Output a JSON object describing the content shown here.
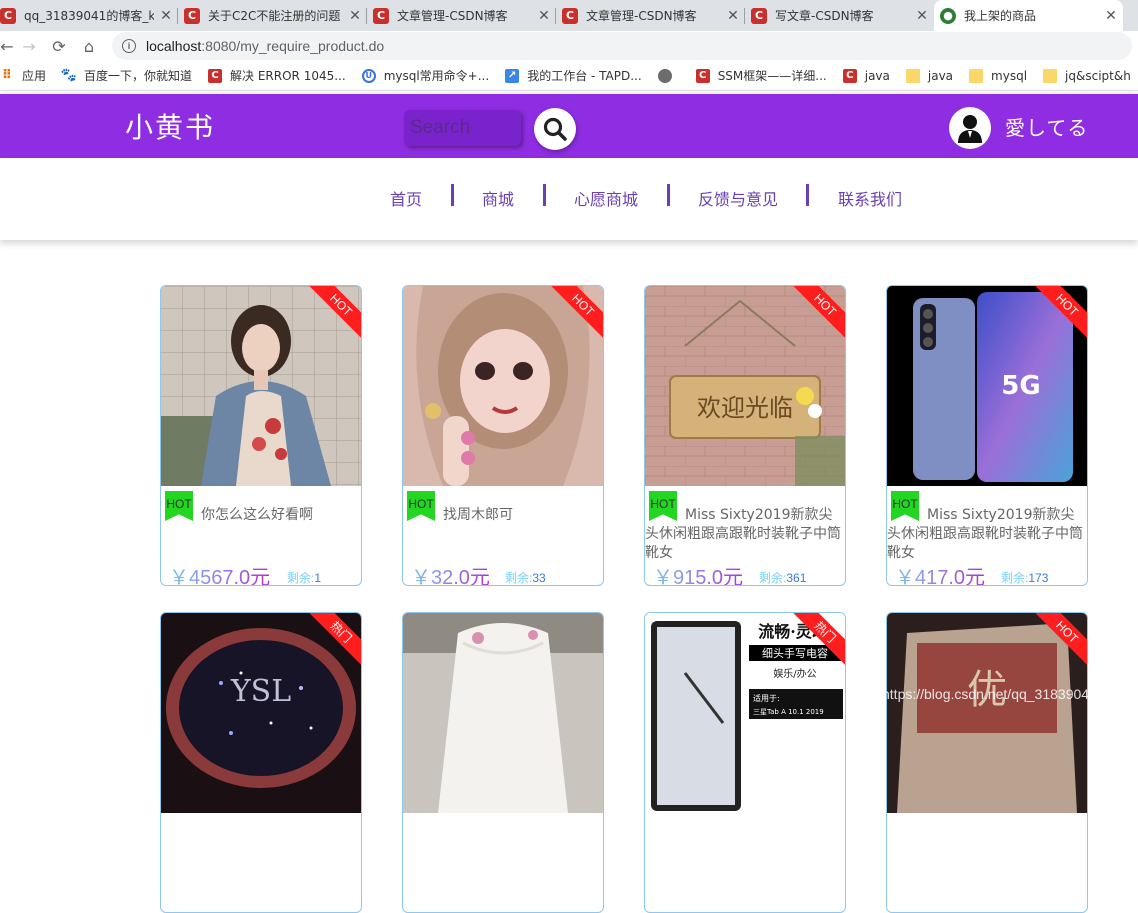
{
  "browser": {
    "tabs": [
      {
        "title": "qq_31839041的博客_k",
        "icon": "csdn-icon",
        "close": "✕"
      },
      {
        "title": "关于C2C不能注册的问题",
        "icon": "csdn-icon",
        "close": "✕"
      },
      {
        "title": "文章管理-CSDN博客",
        "icon": "csdn-icon",
        "close": "✕"
      },
      {
        "title": "文章管理-CSDN博客",
        "icon": "csdn-icon",
        "close": "✕"
      },
      {
        "title": "写文章-CSDN博客",
        "icon": "csdn-icon",
        "close": "✕"
      },
      {
        "title": "我上架的商品",
        "icon": "site-icon",
        "close": "✕"
      }
    ],
    "url_host": "localhost",
    "url_path": ":8080/my_require_product.do",
    "bookmarks": [
      {
        "label": "应用",
        "icon": "apps-grid-icon"
      },
      {
        "label": "百度一下，你就知道",
        "icon": "baidu-icon"
      },
      {
        "label": "解决 ERROR 1045...",
        "icon": "csdn-icon"
      },
      {
        "label": "mysql常用命令+...",
        "icon": "mysql-icon"
      },
      {
        "label": "我的工作台 - TAPD...",
        "icon": "tapd-icon"
      },
      {
        "label": "",
        "icon": "globe-icon"
      },
      {
        "label": "SSM框架——详细...",
        "icon": "csdn-icon"
      },
      {
        "label": "java",
        "icon": "csdn-icon"
      },
      {
        "label": "java",
        "icon": "folder-icon"
      },
      {
        "label": "mysql",
        "icon": "folder-icon"
      },
      {
        "label": "jq&scipt&h",
        "icon": "folder-icon"
      }
    ]
  },
  "header": {
    "logo": "小黄书",
    "search_placeholder": "Search",
    "username": "愛してる",
    "brand_color": "#8e2de2"
  },
  "nav": {
    "items": [
      "首页",
      "商城",
      "心愿商城",
      "反馈与意见",
      "联系我们"
    ]
  },
  "products": [
    {
      "ribbon": "HOT",
      "tag": "HOT",
      "name": "你怎么这么好看啊",
      "price": "￥4567.0元",
      "stock_label": "剩余:",
      "stock": "1"
    },
    {
      "ribbon": "HOT",
      "tag": "HOT",
      "name": "找周木郎可",
      "price": "￥32.0元",
      "stock_label": "剩余:",
      "stock": "33"
    },
    {
      "ribbon": "HOT",
      "tag": "HOT",
      "name": "Miss Sixty2019新款尖头休闲粗跟高跟靴时装靴子中筒靴女",
      "price": "￥915.0元",
      "stock_label": "剩余:",
      "stock": "361"
    },
    {
      "ribbon": "HOT",
      "tag": "HOT",
      "name": "Miss Sixty2019新款尖头休闲粗跟高跟靴时装靴子中筒靴女",
      "price": "￥417.0元",
      "stock_label": "剩余:",
      "stock": "173"
    },
    {
      "ribbon": "热门"
    },
    {
      "ribbon": ""
    },
    {
      "ribbon": "热门"
    },
    {
      "ribbon": "HOT"
    }
  ],
  "image_texts": {
    "phone_badge": "5G",
    "sign_text": "欢迎光临",
    "tablet_title": "流畅·灵动",
    "tablet_sub": "细头手写电容",
    "tablet_sub2": "娱乐/办公",
    "tablet_note": "适用于:",
    "tablet_note2": "三星Tab A 10.1 2019",
    "snack_text": "优"
  },
  "watermark": "https://blog.csdn.net/qq_31839041"
}
